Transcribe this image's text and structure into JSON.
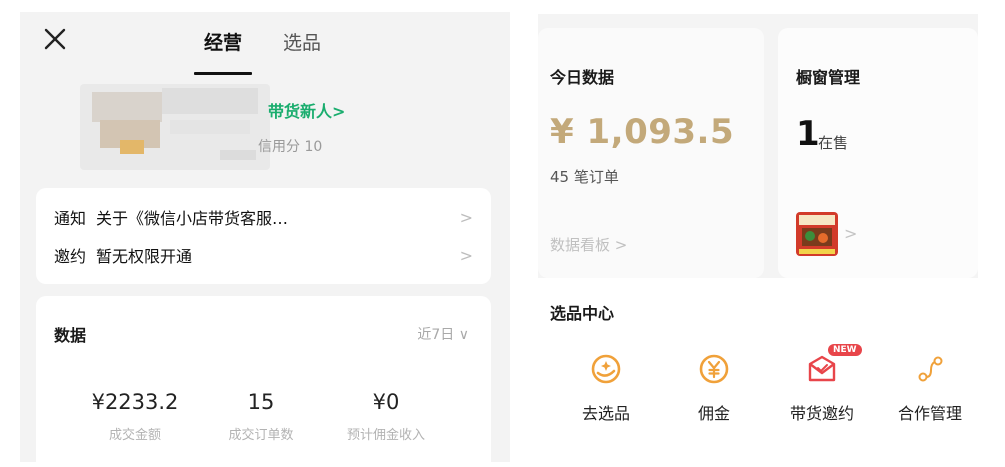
{
  "left": {
    "tabs": [
      {
        "label": "经营",
        "active": true
      },
      {
        "label": "选品",
        "active": false
      }
    ],
    "profile": {
      "badge": "带货新人>",
      "credit": "信用分 10"
    },
    "notices": [
      {
        "tag": "通知",
        "text": "关于《微信小店带货客服…",
        "chevron": ">"
      },
      {
        "tag": "邀约",
        "text": "暂无权限开通",
        "chevron": ">"
      }
    ],
    "data": {
      "title": "数据",
      "period": "近7日 ∨",
      "stats": [
        {
          "value": "¥2233.2",
          "label": "成交金额"
        },
        {
          "value": "15",
          "label": "成交订单数"
        },
        {
          "value": "¥0",
          "label": "预计佣金收入"
        }
      ]
    }
  },
  "right": {
    "today": {
      "title": "今日数据",
      "amount": "¥ 1,093.5",
      "orders": "45 笔订单",
      "link": "数据看板 >"
    },
    "window": {
      "title": "橱窗管理",
      "count": "1",
      "count_unit": "在售",
      "chevron": ">"
    },
    "selection": {
      "title": "选品中心",
      "tools": [
        {
          "label": "去选品",
          "icon": "select-product-icon"
        },
        {
          "label": "佣金",
          "icon": "commission-icon"
        },
        {
          "label": "带货邀约",
          "icon": "invitation-icon",
          "badge": "NEW"
        },
        {
          "label": "合作管理",
          "icon": "cooperation-icon"
        }
      ]
    },
    "colors": {
      "accent_gold": "#c3a97a",
      "new_badge": "#e8454a",
      "green_link": "#1aad6e",
      "icon_orange": "#f0a13a"
    }
  }
}
